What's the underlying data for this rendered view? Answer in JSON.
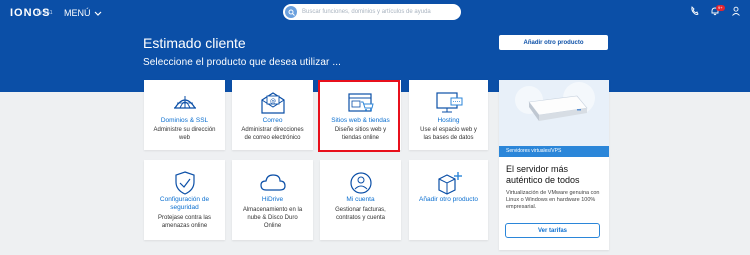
{
  "header": {
    "logo_text": "IONOS",
    "logo_sub": "by 1&1",
    "menu_label": "MENÚ",
    "search_placeholder": "Buscar funciones, dominios y artículos de ayuda",
    "notifications_count": "9+"
  },
  "hero": {
    "greeting": "Estimado cliente",
    "subtitle": "Seleccione el producto que desea utilizar ...",
    "add_product_label": "Añadir otro producto"
  },
  "cards": [
    {
      "title": "Dominios & SSL",
      "desc": "Administre su dirección web",
      "icon": "domain-globe-icon"
    },
    {
      "title": "Correo",
      "desc": "Administrar direcciones de correo electrónico",
      "icon": "envelope-icon"
    },
    {
      "title": "Sitios web & tiendas",
      "desc": "Diseñe sitios web y tiendas online",
      "icon": "website-cart-icon"
    },
    {
      "title": "Hosting",
      "desc": "Use el espacio web y las bases de datos",
      "icon": "monitor-server-icon"
    },
    {
      "title": "Configuración de seguridad",
      "desc": "Protejase contra las amenazas online",
      "icon": "shield-check-icon"
    },
    {
      "title": "HiDrive",
      "desc": "Almacenamiento en la nube & Disco Duro Online",
      "icon": "cloud-icon"
    },
    {
      "title": "Mi cuenta",
      "desc": "Gestionar facturas, contratos y cuenta",
      "icon": "user-account-icon"
    },
    {
      "title": "Añadir otro producto",
      "desc": "",
      "icon": "box-plus-icon"
    }
  ],
  "promo": {
    "tag": "Servidores virtuales/VPS",
    "title": "El servidor más auténtico de todos",
    "desc": "Virtualización de VMware genuina con Linux o Windows en hardware 100% empresarial.",
    "button_label": "Ver tarifas"
  },
  "colors": {
    "header_bg": "#0b4fa7",
    "link": "#0b6fd0",
    "highlight": "#e8101c",
    "accent": "#2b86d9"
  }
}
